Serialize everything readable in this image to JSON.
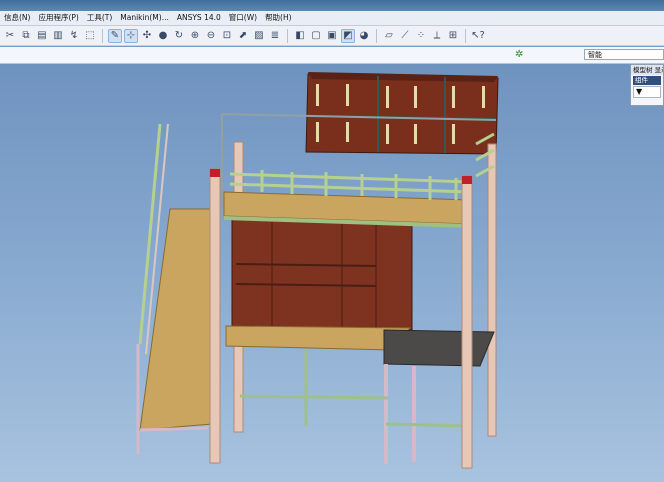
{
  "menu": [
    {
      "label": "信息(N)"
    },
    {
      "label": "应用程序(P)"
    },
    {
      "label": "工具(T)"
    },
    {
      "label": "Manikin(M)..."
    },
    {
      "label": "ANSYS 14.0"
    },
    {
      "label": "窗口(W)"
    },
    {
      "label": "帮助(H)"
    }
  ],
  "toolbar": {
    "icons": [
      "cut-icon",
      "copy-icon",
      "paste-icon",
      "paste-special-icon",
      "regenerate-icon",
      "select-box-icon",
      "sketch-icon",
      "orient-icon",
      "spin-icon",
      "render-icon",
      "repaint-icon",
      "zoom-in-icon",
      "zoom-out-icon",
      "refit-icon",
      "named-view-icon",
      "saved-view-icon",
      "layer-icon",
      "shaded-icon",
      "wireframe-icon",
      "hidden-line-icon",
      "shading-edges-icon",
      "appearance-icon",
      "datum-plane-icon",
      "datum-axis-icon",
      "datum-point-icon",
      "csys-icon",
      "whats-this-icon"
    ]
  },
  "filter": {
    "value": "智能"
  },
  "model_tree_panel": {
    "title": "模型树 显示",
    "item": "组件",
    "filter_glyph": "▼"
  },
  "colors": {
    "viewport_top": "#6f93bf",
    "viewport_bottom": "#a8c3df",
    "wood": "#7a2f1c",
    "plank": "#c9a560",
    "rail": "#b6d08f",
    "post": "#e7c8b6"
  }
}
